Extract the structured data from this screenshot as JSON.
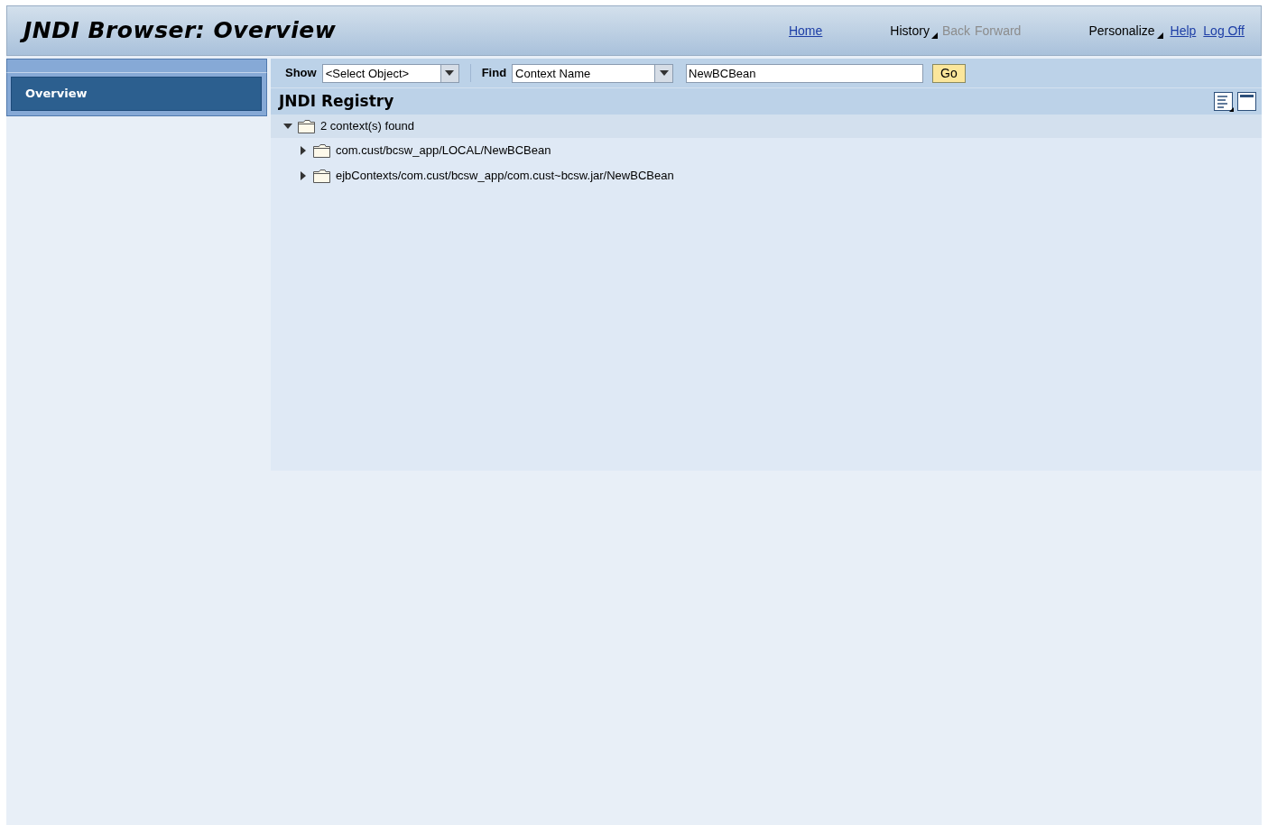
{
  "header": {
    "title": "JNDI Browser: Overview",
    "links": [
      {
        "label": "Home",
        "kind": "link",
        "disabled": false
      },
      {
        "label": "History",
        "kind": "menu",
        "disabled": false
      },
      {
        "label": "Back",
        "kind": "text",
        "disabled": true
      },
      {
        "label": "Forward",
        "kind": "text",
        "disabled": true
      },
      {
        "label": "Personalize",
        "kind": "menu",
        "disabled": false
      },
      {
        "label": "Help",
        "kind": "link",
        "disabled": false
      },
      {
        "label": "Log Off",
        "kind": "link",
        "disabled": false
      }
    ]
  },
  "sidebar": {
    "items": [
      {
        "label": "Overview",
        "selected": true
      }
    ]
  },
  "toolbar": {
    "show_label": "Show",
    "show_value": "<Select Object>",
    "find_label": "Find",
    "find_value": "Context Name",
    "search_value": "NewBCBean",
    "go_button": "Go"
  },
  "panel": {
    "title": "JNDI Registry"
  },
  "tree": [
    {
      "label": "2 context(s) found",
      "expanded": true,
      "children": [
        {
          "label": "com.cust/bcsw_app/LOCAL/NewBCBean",
          "expanded": false
        },
        {
          "label": "ejbContexts/com.cust/bcsw_app/com.cust~bcsw.jar/NewBCBean",
          "expanded": false
        }
      ]
    }
  ]
}
